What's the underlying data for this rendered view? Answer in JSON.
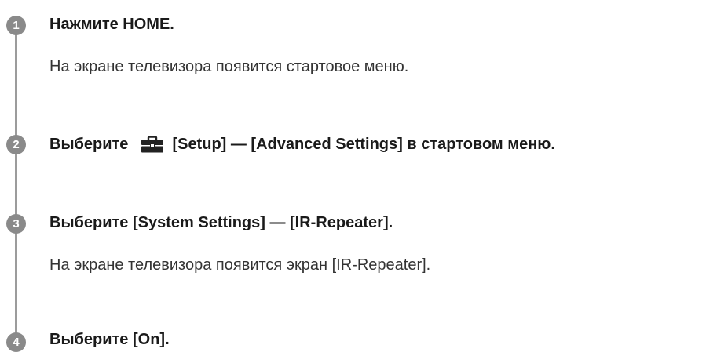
{
  "steps": [
    {
      "number": "1",
      "title": "Нажмите HOME.",
      "description": "На экране телевизора появится стартовое меню."
    },
    {
      "number": "2",
      "title_prefix": "Выберите",
      "icon": "toolbox-icon",
      "title_suffix": "[Setup] — [Advanced Settings] в стартовом меню."
    },
    {
      "number": "3",
      "title": "Выберите [System Settings] — [IR-Repeater].",
      "description": "На экране телевизора появится экран [IR-Repeater]."
    },
    {
      "number": "4",
      "title": "Выберите [On]."
    }
  ],
  "colors": {
    "step_circle": "#8a8a8a",
    "timeline": "#9c9c9c",
    "text": "#1a1a1a"
  }
}
